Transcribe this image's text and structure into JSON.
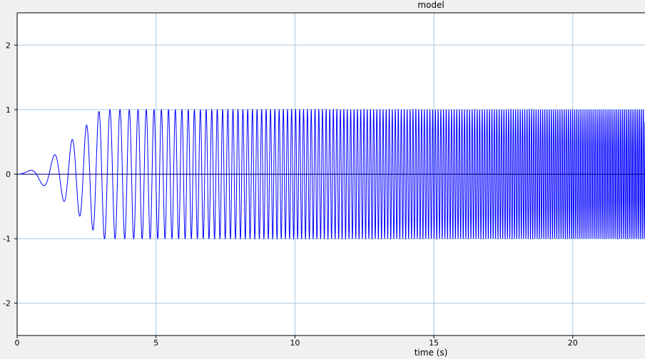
{
  "chart_data": {
    "type": "line",
    "title": "model",
    "xlabel": "time (s)",
    "ylabel": "",
    "xlim": [
      0,
      22.6
    ],
    "ylim": [
      -2.5,
      2.5
    ],
    "x_ticks": [
      0,
      5,
      10,
      15,
      20
    ],
    "y_ticks": [
      2,
      1,
      0,
      -1,
      -2
    ],
    "grid": true,
    "colors": {
      "series": "#0000ff",
      "grid": "#a8c8e0",
      "background": "#ffffff",
      "page": "#f0f0f0",
      "axis": "#000000"
    },
    "series": [
      {
        "name": "",
        "description_type": "chirp",
        "amplitude": 1,
        "envelope_ramp_seconds": [
          0,
          3
        ],
        "frequency_start_hz": 0.5,
        "frequency_end_hz": 15,
        "duration_s": 22.6
      },
      {
        "name": "",
        "description_type": "constant",
        "value": 0
      }
    ]
  }
}
